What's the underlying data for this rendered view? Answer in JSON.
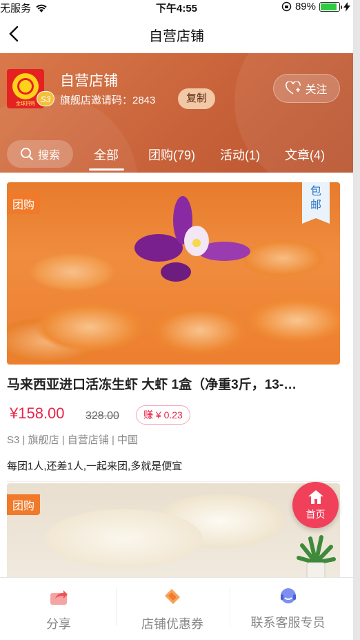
{
  "status": {
    "carrier": "无服务",
    "time": "下午4:55",
    "battery": "89%",
    "battery_level": 0.89
  },
  "nav": {
    "title": "自营店铺"
  },
  "shop": {
    "name": "自营店铺",
    "invite_label": "旗舰店邀请码：2843",
    "copy_label": "复制",
    "follow_label": "关注",
    "level_badge": "S3",
    "logo_text": "金球拼购"
  },
  "tabs": {
    "search_label": "搜索",
    "items": [
      {
        "label": "全部"
      },
      {
        "label": "团购(79)"
      },
      {
        "label": "活动(1)"
      },
      {
        "label": "文章(4)"
      }
    ]
  },
  "products": [
    {
      "tag": "团购",
      "shipping_badge": "包\n邮",
      "title": "马来西亚进口活冻生虾 大虾 1盒（净重3斤，13-…",
      "price": "¥158.00",
      "old_price": "328.00",
      "earn": "赚 ¥ 0.23",
      "meta": "S3 | 旗舰店 | 自营店铺 | 中国",
      "desc": "每团1人,还差1人,一起来团,多就是便宜"
    },
    {
      "tag": "团购"
    }
  ],
  "fab": {
    "label": "首页"
  },
  "bottom_bar": [
    {
      "label": "分享"
    },
    {
      "label": "店铺优惠券"
    },
    {
      "label": "联系客服专员"
    }
  ],
  "colors": {
    "accent": "#e8254a",
    "banner": "#c8623a",
    "tag": "#f07a2a"
  }
}
